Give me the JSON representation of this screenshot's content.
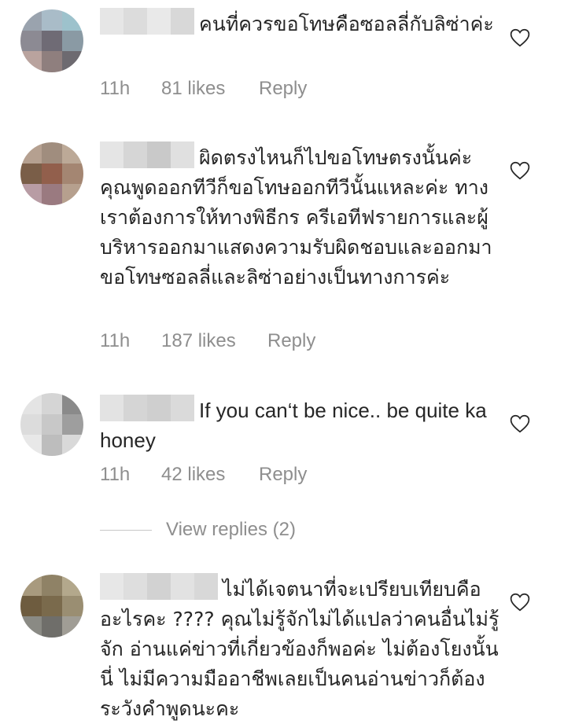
{
  "comments": [
    {
      "text": "คนที่ควรขอโทษคือซอลลี่กับลิซ่าค่ะ",
      "time": "11h",
      "likes": "81 likes",
      "reply": "Reply"
    },
    {
      "text": "ผิดตรงไหนก็ไปขอโทษตรงนั้นค่ะ คุณพูดออกทีวีก็ขอโทษออกทีวีนั้นแหละค่ะ ทางเราต้องการให้ทางพิธีกร ครีเอทีฟรายการและผู้บริหารออกมาแสดงความรับผิดชอบและออกมาขอโทษซอลลี่และลิซ่าอย่างเป็นทางการค่ะ",
      "time": "11h",
      "likes": "187 likes",
      "reply": "Reply"
    },
    {
      "text": "If you can‘t be nice.. be quite ka honey",
      "time": "11h",
      "likes": "42 likes",
      "reply": "Reply",
      "view_replies": "View replies (2)"
    },
    {
      "text": "ไม่ได้เจตนาที่จะเปรียบเทียบคืออะไรคะ ???? คุณไม่รู้จักไม่ได้แปลว่าคนอื่นไม่รู้จัก อ่านแค่ข่าวที่เกี่ยวข้องก็พอค่ะ ไม่ต้องโยงนั้นนี่ ไม่มีความมืออาชีพเลยเป็นคนอ่านข่าวก็ต้องระวังคำพูดนะคะ"
    }
  ],
  "icons": {
    "like": "heart-outline-icon",
    "avatar": "pixelated-avatar",
    "username": "pixelated-username"
  },
  "colors": {
    "text": "#262626",
    "meta": "#8e8e8e",
    "divider": "#c7c7c7"
  }
}
